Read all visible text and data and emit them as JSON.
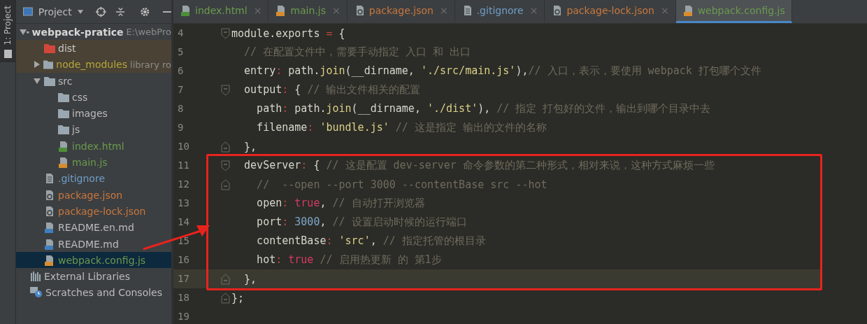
{
  "side_strip": {
    "tab": {
      "label": "1: Project",
      "selected": true
    }
  },
  "project_panel": {
    "title": "Project",
    "items": [
      {
        "label": "webpack-pratice",
        "hint": "E:\\webPro",
        "kind": "module",
        "color": "#d6d6d6",
        "expanded": true,
        "selected": false,
        "excluded": false,
        "children": [
          {
            "label": "dist",
            "kind": "excluded-folder",
            "color": "#c8c8c8",
            "selected": false,
            "excluded": true
          },
          {
            "label": "node_modules",
            "hint": "library ro",
            "kind": "library-folder",
            "color": "#b3a73a",
            "expanded": false,
            "selected": false,
            "excluded": true
          },
          {
            "label": "src",
            "kind": "folder",
            "color": "#bbbbbb",
            "expanded": true,
            "selected": false,
            "excluded": false,
            "children": [
              {
                "label": "css",
                "kind": "folder",
                "color": "#bbbbbb",
                "selected": false,
                "excluded": false
              },
              {
                "label": "images",
                "kind": "folder",
                "color": "#bbbbbb",
                "selected": false,
                "excluded": false
              },
              {
                "label": "js",
                "kind": "folder",
                "color": "#bbbbbb",
                "selected": false,
                "excluded": false
              },
              {
                "label": "index.html",
                "kind": "html",
                "color": "#6a9a4e",
                "selected": false,
                "excluded": false
              },
              {
                "label": "main.js",
                "kind": "js",
                "color": "#6a9a4e",
                "selected": false,
                "excluded": false
              }
            ]
          },
          {
            "label": ".gitignore",
            "kind": "text",
            "color": "#6f9ec9",
            "selected": false,
            "excluded": false
          },
          {
            "label": "package.json",
            "kind": "json",
            "color": "#c9773e",
            "selected": false,
            "excluded": false
          },
          {
            "label": "package-lock.json",
            "kind": "json",
            "color": "#c9773e",
            "selected": false,
            "excluded": false
          },
          {
            "label": "README.en.md",
            "kind": "md",
            "color": "#bbbbbb",
            "selected": false,
            "excluded": false
          },
          {
            "label": "README.md",
            "kind": "md",
            "color": "#bbbbbb",
            "selected": false,
            "excluded": false
          },
          {
            "label": "webpack.config.js",
            "kind": "js",
            "color": "#6a9a4e",
            "selected": true,
            "excluded": false
          }
        ]
      },
      {
        "label": "External Libraries",
        "kind": "libraries",
        "color": "#bbbbbb",
        "selected": false,
        "excluded": false
      },
      {
        "label": "Scratches and Consoles",
        "kind": "scratches",
        "color": "#bbbbbb",
        "selected": false,
        "excluded": false
      }
    ]
  },
  "tabs": [
    {
      "label": "index.html",
      "kind": "html",
      "color": "#6a9a4e",
      "close": "×",
      "selected": false
    },
    {
      "label": "main.js",
      "kind": "js",
      "color": "#6a9a4e",
      "close": "×",
      "selected": false
    },
    {
      "label": "package.json",
      "kind": "json",
      "color": "#c9773e",
      "close": "×",
      "selected": false
    },
    {
      "label": ".gitignore",
      "kind": "text",
      "color": "#6f9ec9",
      "close": "×",
      "selected": false
    },
    {
      "label": "package-lock.json",
      "kind": "json",
      "color": "#c9773e",
      "close": "×",
      "selected": false
    },
    {
      "label": "webpack.config.js",
      "kind": "js",
      "color": "#6a9a4e",
      "selected": true
    }
  ],
  "editor": {
    "lines": [
      {
        "number": "4",
        "fold": {
          "kind": "start"
        },
        "boxed": false,
        "current": false,
        "tokens": [
          {
            "kind": "plain",
            "text": "module.exports "
          },
          {
            "kind": "op",
            "text": "="
          },
          {
            "kind": "plain",
            "text": " {"
          }
        ]
      },
      {
        "number": "5",
        "boxed": false,
        "current": false,
        "tokens": [
          {
            "kind": "cmt",
            "text": "  // 在配置文件中，需要手动指定 入口 和 出口"
          }
        ]
      },
      {
        "number": "6",
        "boxed": false,
        "current": false,
        "tokens": [
          {
            "kind": "plain",
            "text": "  entry"
          },
          {
            "kind": "op",
            "text": ":"
          },
          {
            "kind": "plain",
            "text": " path."
          },
          {
            "kind": "fn",
            "text": "join"
          },
          {
            "kind": "plain",
            "text": "(__dirname, "
          },
          {
            "kind": "str",
            "text": "'./src/main.js'"
          },
          {
            "kind": "plain",
            "text": "),"
          },
          {
            "kind": "cmt",
            "text": "// 入口，表示，要使用 webpack 打包哪个文件"
          }
        ]
      },
      {
        "number": "7",
        "fold": {
          "kind": "start"
        },
        "boxed": false,
        "current": false,
        "tokens": [
          {
            "kind": "plain",
            "text": "  output"
          },
          {
            "kind": "op",
            "text": ":"
          },
          {
            "kind": "plain",
            "text": " { "
          },
          {
            "kind": "cmt",
            "text": "// 输出文件相关的配置"
          }
        ]
      },
      {
        "number": "8",
        "boxed": false,
        "current": false,
        "tokens": [
          {
            "kind": "plain",
            "text": "    path"
          },
          {
            "kind": "op",
            "text": ":"
          },
          {
            "kind": "plain",
            "text": " path."
          },
          {
            "kind": "fn",
            "text": "join"
          },
          {
            "kind": "plain",
            "text": "(__dirname, "
          },
          {
            "kind": "str",
            "text": "'./dist'"
          },
          {
            "kind": "plain",
            "text": "), "
          },
          {
            "kind": "cmt",
            "text": "// 指定 打包好的文件，输出到哪个目录中去"
          }
        ]
      },
      {
        "number": "9",
        "boxed": false,
        "current": false,
        "tokens": [
          {
            "kind": "plain",
            "text": "    filename"
          },
          {
            "kind": "op",
            "text": ": "
          },
          {
            "kind": "str",
            "text": "'bundle.js'"
          },
          {
            "kind": "cmt",
            "text": " // 这是指定 输出的文件的名称"
          }
        ]
      },
      {
        "number": "10",
        "fold": {
          "kind": "end"
        },
        "boxed": false,
        "current": false,
        "tokens": [
          {
            "kind": "plain",
            "text": "  },"
          }
        ]
      },
      {
        "number": "11",
        "fold": {
          "kind": "start"
        },
        "boxed": true,
        "current": false,
        "tokens": [
          {
            "kind": "plain",
            "text": "  devServer"
          },
          {
            "kind": "op",
            "text": ":"
          },
          {
            "kind": "plain",
            "text": " { "
          },
          {
            "kind": "cmt",
            "text": "// 这是配置 dev-server 命令参数的第二种形式，相对来说，这种方式麻烦一些"
          }
        ]
      },
      {
        "number": "12",
        "fold": {
          "kind": "end"
        },
        "boxed": true,
        "current": false,
        "tokens": [
          {
            "kind": "cmt",
            "text": "    //  --open --port 3000 --contentBase src --hot"
          }
        ]
      },
      {
        "number": "13",
        "boxed": true,
        "current": false,
        "tokens": [
          {
            "kind": "plain",
            "text": "    open"
          },
          {
            "kind": "op",
            "text": ": "
          },
          {
            "kind": "kw",
            "text": "true"
          },
          {
            "kind": "plain",
            "text": ", "
          },
          {
            "kind": "cmt",
            "text": "// 自动打开浏览器"
          }
        ]
      },
      {
        "number": "14",
        "boxed": true,
        "current": false,
        "tokens": [
          {
            "kind": "plain",
            "text": "    port"
          },
          {
            "kind": "op",
            "text": ": "
          },
          {
            "kind": "num",
            "text": "3000"
          },
          {
            "kind": "plain",
            "text": ", "
          },
          {
            "kind": "cmt",
            "text": "// 设置启动时候的运行端口"
          }
        ]
      },
      {
        "number": "15",
        "boxed": true,
        "current": false,
        "tokens": [
          {
            "kind": "plain",
            "text": "    contentBase"
          },
          {
            "kind": "op",
            "text": ": "
          },
          {
            "kind": "str",
            "text": "'src'"
          },
          {
            "kind": "plain",
            "text": ", "
          },
          {
            "kind": "cmt",
            "text": "// 指定托管的根目录"
          }
        ]
      },
      {
        "number": "16",
        "boxed": true,
        "current": false,
        "tokens": [
          {
            "kind": "plain",
            "text": "    hot"
          },
          {
            "kind": "op",
            "text": ": "
          },
          {
            "kind": "kw",
            "text": "true"
          },
          {
            "kind": "cmt",
            "text": " // 启用热更新 的 第1步"
          }
        ]
      },
      {
        "number": "17",
        "fold": {
          "kind": "end"
        },
        "boxed": true,
        "current": true,
        "tokens": [
          {
            "kind": "plain",
            "text": "  },"
          }
        ]
      },
      {
        "number": "18",
        "fold": {
          "kind": "end"
        },
        "boxed": false,
        "current": false,
        "tokens": [
          {
            "kind": "plain",
            "text": "};"
          }
        ]
      },
      {
        "number": "19",
        "boxed": false,
        "current": false
      }
    ]
  }
}
